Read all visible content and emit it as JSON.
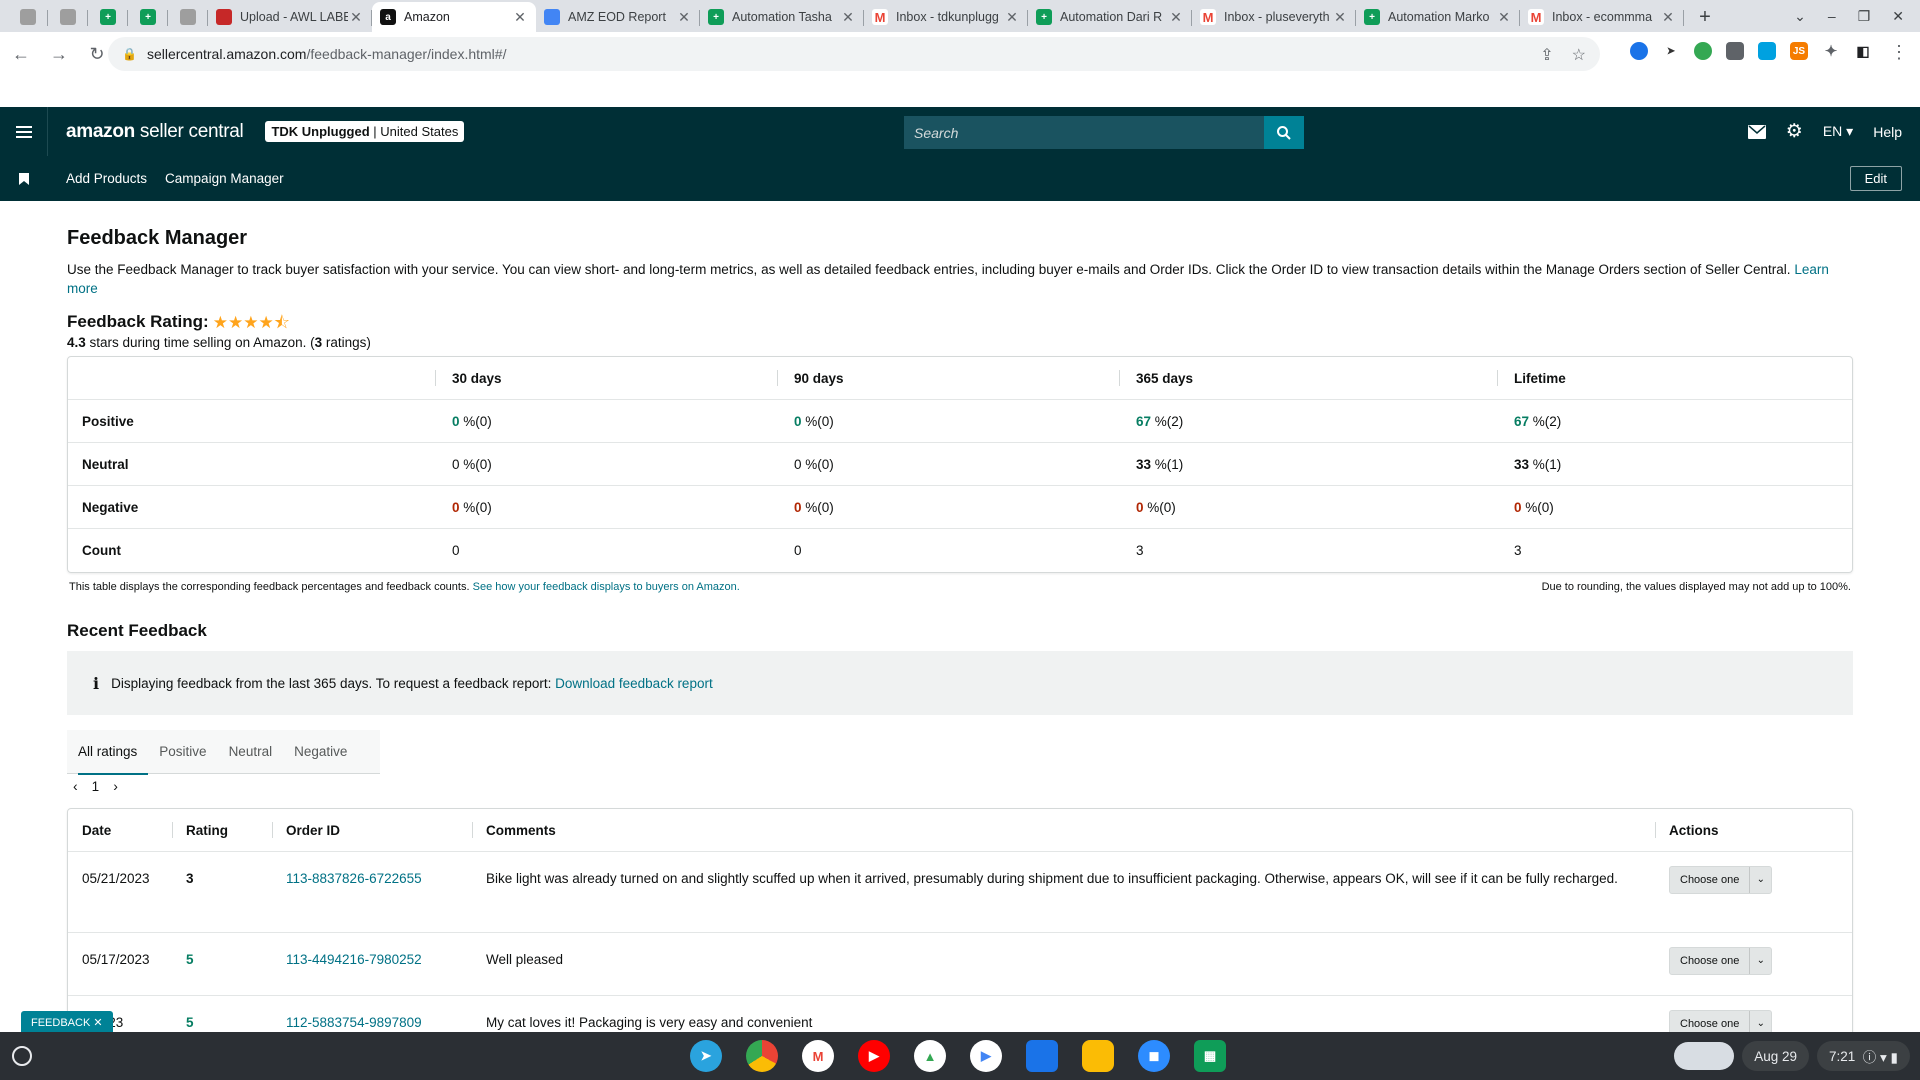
{
  "browser": {
    "tabs": [
      {
        "label": "",
        "icon": "generic-icon",
        "kind": "gen"
      },
      {
        "label": "",
        "icon": "generic-icon",
        "kind": "gen"
      },
      {
        "label": "",
        "icon": "sheets-icon",
        "kind": "sheets"
      },
      {
        "label": "",
        "icon": "sheets-icon",
        "kind": "sheets"
      },
      {
        "label": "",
        "icon": "generic-icon",
        "kind": "gen"
      },
      {
        "label": "Upload - AWL LABE",
        "icon": "awl-icon",
        "kind": "awl"
      },
      {
        "label": "Amazon",
        "icon": "amazon-icon",
        "kind": "amazon",
        "active": true
      },
      {
        "label": "AMZ EOD Report",
        "icon": "amz-icon",
        "kind": "amz"
      },
      {
        "label": "Automation Tasha",
        "icon": "sheets-icon",
        "kind": "sheets"
      },
      {
        "label": "Inbox - tdkunplugg",
        "icon": "gmail-icon",
        "kind": "gmail"
      },
      {
        "label": "Automation Dari R",
        "icon": "sheets-icon",
        "kind": "sheets"
      },
      {
        "label": "Inbox - pluseveryth",
        "icon": "gmail-icon",
        "kind": "gmail"
      },
      {
        "label": "Automation Marko",
        "icon": "sheets-icon",
        "kind": "sheets"
      },
      {
        "label": "Inbox - ecommma",
        "icon": "gmail-icon",
        "kind": "gmail"
      }
    ],
    "url_domain": "sellercentral.amazon.com",
    "url_path": "/feedback-manager/index.html#/"
  },
  "header": {
    "logo_bold": "amazon",
    "logo_rest": " seller central",
    "store_name": "TDK Unplugged",
    "store_region": "United States",
    "search_placeholder": "Search",
    "language": "EN",
    "help": "Help"
  },
  "subnav": {
    "items": [
      "Add Products",
      "Campaign Manager"
    ],
    "edit": "Edit"
  },
  "page": {
    "title": "Feedback Manager",
    "intro": "Use the Feedback Manager to track buyer satisfaction with your service. You can view short- and long-term metrics, as well as detailed feedback entries, including buyer e-mails and Order IDs. Click the Order ID to view transaction details within the Manage Orders section of Seller Central.",
    "learn_more": "Learn more",
    "rating_title": "Feedback Rating:",
    "rating_stars": 4.3,
    "rating_value": "4.3",
    "rating_text": " stars during time selling on Amazon. (",
    "rating_count": "3",
    "rating_text_end": " ratings)"
  },
  "stats": {
    "columns": [
      "30 days",
      "90 days",
      "365 days",
      "Lifetime"
    ],
    "rows": [
      {
        "label": "Positive",
        "kind": "pos",
        "values": [
          [
            "0",
            " %(0)"
          ],
          [
            "0",
            " %(0)"
          ],
          [
            "67",
            " %(2)"
          ],
          [
            "67",
            " %(2)"
          ]
        ]
      },
      {
        "label": "Neutral",
        "kind": "neu",
        "values": [
          [
            "0",
            " %(0)"
          ],
          [
            "0",
            " %(0)"
          ],
          [
            "33",
            " %(1)"
          ],
          [
            "33",
            " %(1)"
          ]
        ]
      },
      {
        "label": "Negative",
        "kind": "neg",
        "values": [
          [
            "0",
            " %(0)"
          ],
          [
            "0",
            " %(0)"
          ],
          [
            "0",
            " %(0)"
          ],
          [
            "0",
            " %(0)"
          ]
        ]
      },
      {
        "label": "Count",
        "kind": "count",
        "values": [
          [
            "0",
            ""
          ],
          [
            "0",
            ""
          ],
          [
            "3",
            ""
          ],
          [
            "3",
            ""
          ]
        ]
      }
    ],
    "note_left": "This table displays the corresponding feedback percentages and feedback counts.",
    "note_link": "See how your feedback displays to buyers on Amazon.",
    "note_right": "Due to rounding, the values displayed may not add up to 100%."
  },
  "recent": {
    "title": "Recent Feedback",
    "info_text": "Displaying feedback from the last 365 days. To request a feedback report:",
    "info_link": "Download feedback report",
    "tabs": [
      "All ratings",
      "Positive",
      "Neutral",
      "Negative"
    ],
    "active_tab": "All ratings",
    "page": "1",
    "columns": [
      "Date",
      "Rating",
      "Order ID",
      "Comments",
      "Actions"
    ],
    "rows": [
      {
        "date": "05/21/2023",
        "rating": "3",
        "order": "113-8837826-6722655",
        "comment": "Bike light was already turned on and slightly scuffed up when it arrived, presumably during shipment due to insufficient packaging. Otherwise, appears OK, will see if it can be fully recharged.",
        "action": "Choose one"
      },
      {
        "date": "05/17/2023",
        "rating": "5",
        "order": "113-4494216-7980252",
        "comment": "Well pleased",
        "action": "Choose one"
      },
      {
        "date": "8/2023",
        "rating": "5",
        "order": "112-5883754-9897809",
        "comment": "My cat loves it! Packaging is very easy and convenient",
        "action": "Choose one"
      }
    ]
  },
  "feedback_pill": "FEEDBACK",
  "shelf": {
    "date": "Aug 29",
    "time": "7:21"
  }
}
